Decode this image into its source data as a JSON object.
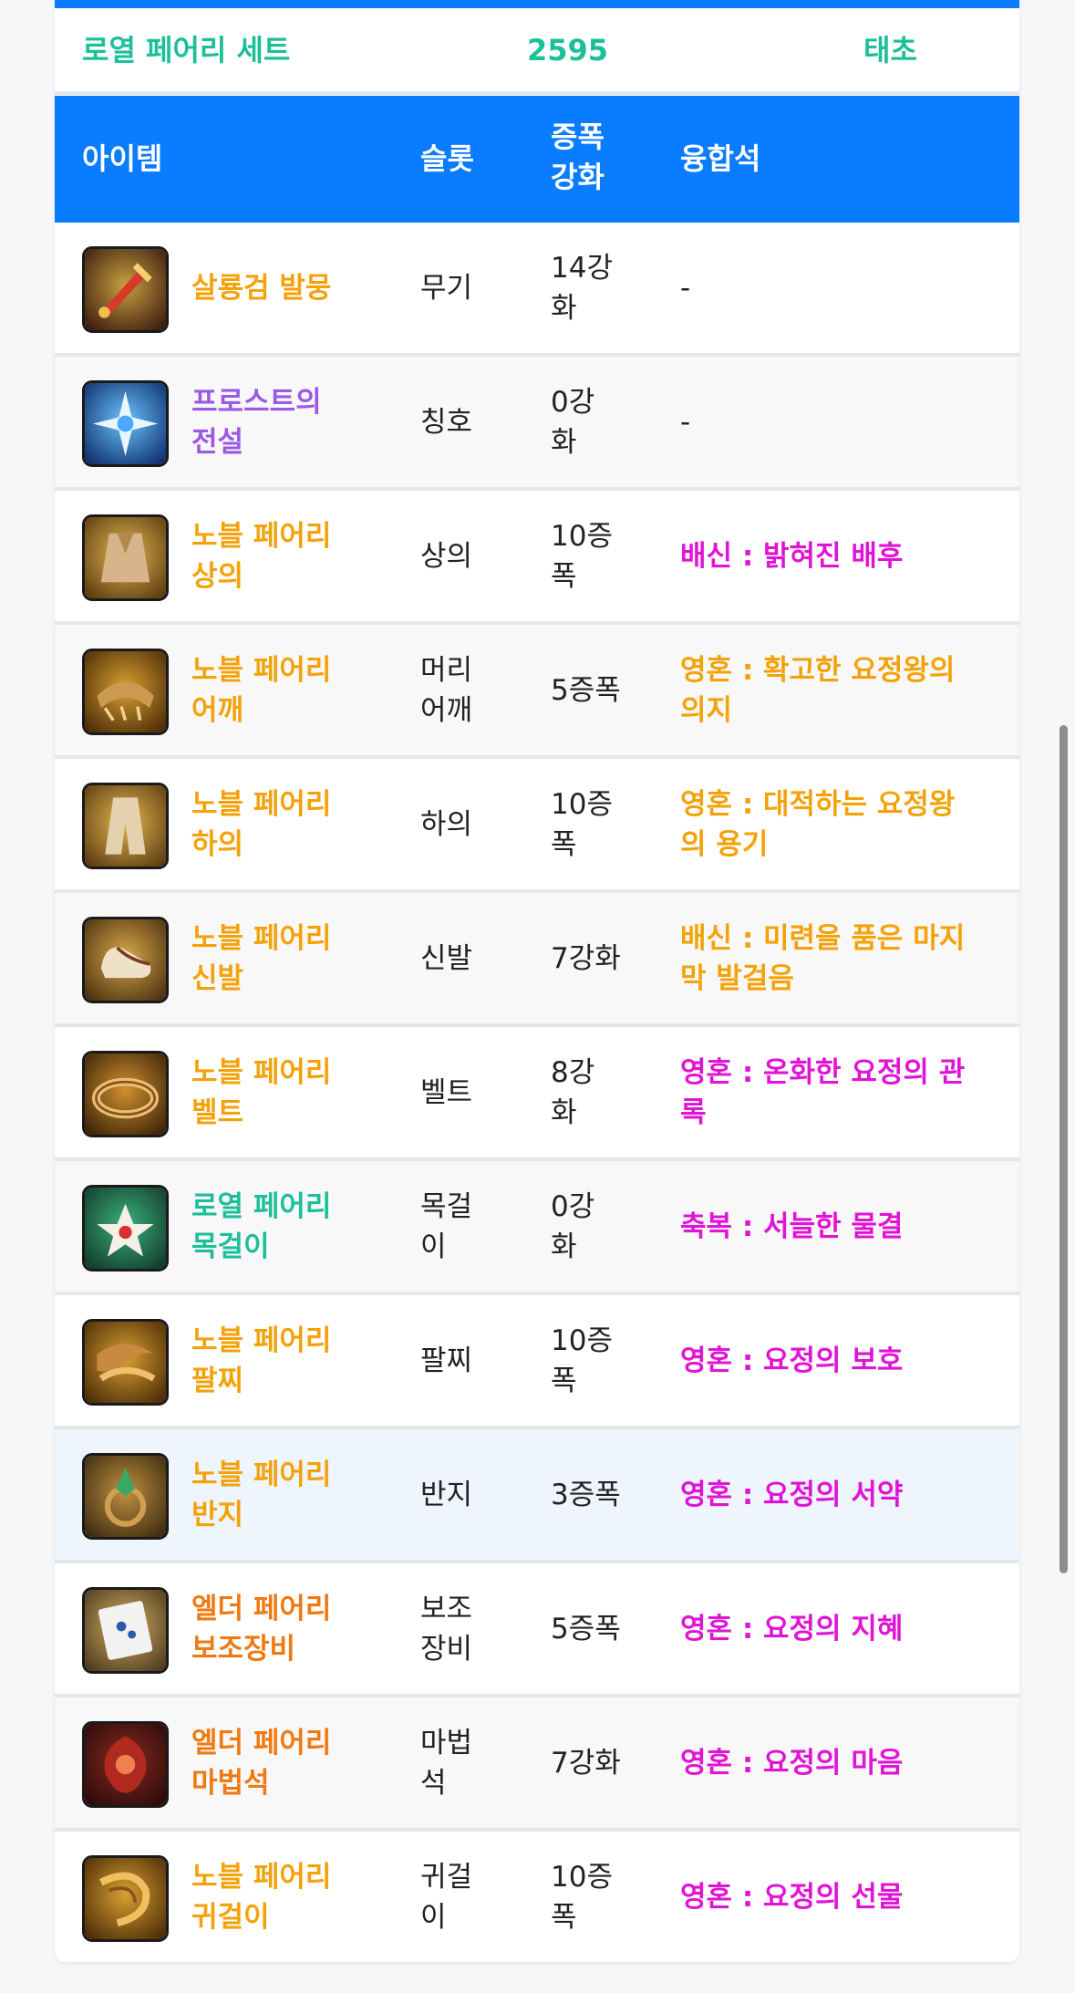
{
  "set": {
    "name": "로열 페어리 세트",
    "score": "2595",
    "grade": "태초",
    "color": "#1cbf9a"
  },
  "header": {
    "item": "아이템",
    "slot": "슬롯",
    "amp": "증폭\n강화",
    "fusion": "융합석",
    "bg": "#0a7cff"
  },
  "rows": [
    {
      "name": "살룡검 발뭉",
      "name_color": "#f4a20a",
      "slot": "무기",
      "amp": "14강\n화",
      "fusion": "-",
      "fusion_color": "#222222",
      "icon": "sword-icon"
    },
    {
      "name": "프로스트의\n전설",
      "name_color": "#9b59e6",
      "slot": "칭호",
      "amp": "0강\n화",
      "fusion": "-",
      "fusion_color": "#222222",
      "icon": "frost-title-icon"
    },
    {
      "name": "노블 페어리\n상의",
      "name_color": "#f4a20a",
      "slot": "상의",
      "amp": "10증\n폭",
      "fusion": "배신 : 밝혀진 배후",
      "fusion_color": "#e114d6",
      "icon": "top-armor-icon"
    },
    {
      "name": "노블 페어리\n어깨",
      "name_color": "#f4a20a",
      "slot": "머리\n어깨",
      "amp": "5증폭",
      "fusion": "영혼 : 확고한 요정왕의\n의지",
      "fusion_color": "#f4a20a",
      "icon": "shoulder-armor-icon"
    },
    {
      "name": "노블 페어리\n하의",
      "name_color": "#f4a20a",
      "slot": "하의",
      "amp": "10증\n폭",
      "fusion": "영혼 : 대적하는 요정왕\n의 용기",
      "fusion_color": "#f4a20a",
      "icon": "bottom-armor-icon"
    },
    {
      "name": "노블 페어리\n신발",
      "name_color": "#f4a20a",
      "slot": "신발",
      "amp": "7강화",
      "fusion": "배신 : 미련을 품은 마지\n막 발걸음",
      "fusion_color": "#f4a20a",
      "icon": "shoes-icon"
    },
    {
      "name": "노블 페어리\n벨트",
      "name_color": "#f4a20a",
      "slot": "벨트",
      "amp": "8강\n화",
      "fusion": "영혼 : 온화한 요정의 관\n록",
      "fusion_color": "#e114d6",
      "icon": "belt-icon"
    },
    {
      "name": "로열 페어리\n목걸이",
      "name_color": "#1cbf9a",
      "slot": "목걸\n이",
      "amp": "0강\n화",
      "fusion": "축복 : 서늘한 물결",
      "fusion_color": "#e114d6",
      "icon": "necklace-icon"
    },
    {
      "name": "노블 페어리\n팔찌",
      "name_color": "#f4a20a",
      "slot": "팔찌",
      "amp": "10증\n폭",
      "fusion": "영혼 : 요정의 보호",
      "fusion_color": "#e114d6",
      "icon": "bracelet-icon"
    },
    {
      "name": "노블 페어리\n반지",
      "name_color": "#f4a20a",
      "slot": "반지",
      "amp": "3증폭",
      "fusion": "영혼 : 요정의 서약",
      "fusion_color": "#e114d6",
      "icon": "ring-icon"
    },
    {
      "name": "엘더 페어리\n보조장비",
      "name_color": "#f07a12",
      "slot": "보조\n장비",
      "amp": "5증폭",
      "fusion": "영혼 : 요정의 지혜",
      "fusion_color": "#e114d6",
      "icon": "support-gear-icon"
    },
    {
      "name": "엘더 페어리\n마법석",
      "name_color": "#f07a12",
      "slot": "마법\n석",
      "amp": "7강화",
      "fusion": "영혼 : 요정의 마음",
      "fusion_color": "#e114d6",
      "icon": "magic-stone-icon"
    },
    {
      "name": "노블 페어리\n귀걸이",
      "name_color": "#f4a20a",
      "slot": "귀걸\n이",
      "amp": "10증\n폭",
      "fusion": "영혼 : 요정의 선물",
      "fusion_color": "#e114d6",
      "icon": "earring-icon"
    }
  ]
}
